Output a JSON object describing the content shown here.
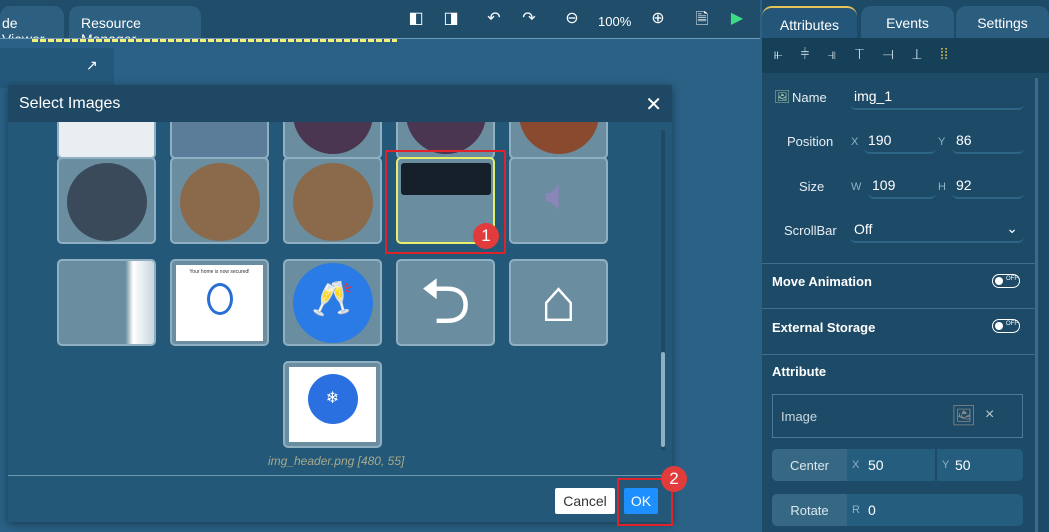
{
  "topbar": {
    "tabs": [
      "de Viewer",
      "Resource Manager"
    ],
    "zoom": "100%"
  },
  "dialog": {
    "title": "Select Images",
    "caption": "img_header.png [480, 55]",
    "thumb_text": "Your home is now secured!",
    "cancel": "Cancel",
    "ok": "OK"
  },
  "annotations": [
    "1",
    "2"
  ],
  "panel": {
    "tabs": [
      "Attributes",
      "Events",
      "Settings"
    ],
    "name_label": "Name",
    "name": "img_1",
    "position_label": "Position",
    "x_label": "X",
    "x": "190",
    "y_label": "Y",
    "y": "86",
    "size_label": "Size",
    "w_label": "W",
    "w": "109",
    "h_label": "H",
    "h": "92",
    "scrollbar_label": "ScrollBar",
    "scrollbar": "Off",
    "move_animation": "Move Animation",
    "external_storage": "External Storage",
    "toggle_off": "OFF",
    "attribute": "Attribute",
    "image_label": "Image",
    "clear": "×",
    "center_label": "Center",
    "cx": "50",
    "cy": "50",
    "rotate_label": "Rotate",
    "r_label": "R",
    "r": "0"
  }
}
